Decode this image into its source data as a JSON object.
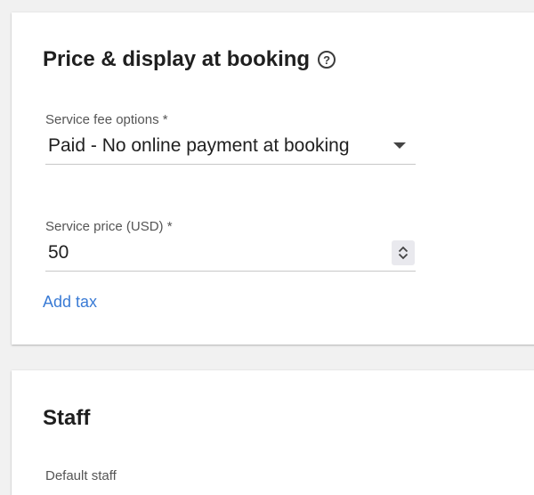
{
  "price_section": {
    "title": "Price & display at booking",
    "help_icon": "help-circle-icon",
    "help_glyph": "?",
    "service_fee": {
      "label": "Service fee options *",
      "value": "Paid - No online payment at booking"
    },
    "service_price": {
      "label": "Service price (USD) *",
      "value": "50"
    },
    "add_tax_label": "Add tax"
  },
  "staff_section": {
    "title": "Staff",
    "default_staff_label": "Default staff"
  },
  "colors": {
    "link": "#3a7bd5",
    "card_bg": "#ffffff",
    "page_bg": "#f1f1f1"
  }
}
